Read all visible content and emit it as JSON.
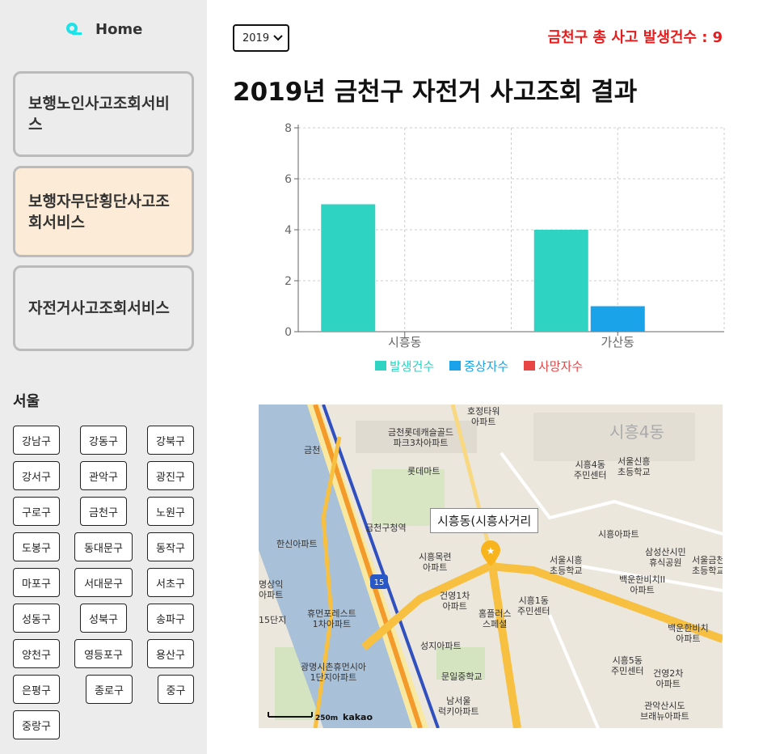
{
  "sidebar": {
    "home_label": "Home",
    "services": [
      {
        "label": "보행노인사고조회서비스",
        "active": false
      },
      {
        "label": "보행자무단횡단사고조회서비스",
        "active": true
      },
      {
        "label": "자전거사고조회서비스",
        "active": false
      }
    ],
    "region_title": "서울",
    "districts": [
      "강남구",
      "강동구",
      "강북구",
      "강서구",
      "관악구",
      "광진구",
      "구로구",
      "금천구",
      "노원구",
      "도봉구",
      "동대문구",
      "동작구",
      "마포구",
      "서대문구",
      "서초구",
      "성동구",
      "성북구",
      "송파구",
      "양천구",
      "영등포구",
      "용산구",
      "은평구",
      "종로구",
      "중구",
      "중랑구"
    ]
  },
  "header": {
    "year_selected": "2019",
    "total_label": "금천구 총 사고 발생건수 :",
    "total_count": "9",
    "title": "2019년 금천구 자전거 사고조회 결과"
  },
  "chart_data": {
    "type": "bar",
    "categories": [
      "시흥동",
      "가산동"
    ],
    "series": [
      {
        "name": "발생건수",
        "values": [
          5,
          4
        ],
        "color": "#2ed3c1"
      },
      {
        "name": "중상자수",
        "values": [
          0,
          1
        ],
        "color": "#1aa3e8"
      },
      {
        "name": "사망자수",
        "values": [
          0,
          0
        ],
        "color": "#e84545"
      }
    ],
    "ylim": [
      0,
      8
    ],
    "yticks": [
      0,
      2,
      4,
      6,
      8
    ],
    "grid": true,
    "legend": "bottom"
  },
  "map": {
    "tooltip": "시흥동(시흥사거리",
    "labels": [
      "호정타워 아파트",
      "금천롯데캐슬골드 파크3차아파트",
      "롯데마트",
      "시흥4동",
      "시흥4동 주민센터",
      "서울신흥 초등학교",
      "금천구청역",
      "한신아파트",
      "시흥목련 아파트",
      "시흥아파트",
      "삼성산시민 휴식공원",
      "서울시흥 초등학교",
      "서울금천 초등학교",
      "백운한비치II 아파트",
      "명상익 아파트",
      "휴먼포레스트 1차아파트",
      "건영1차 아파트",
      "시흥1동 주민센터",
      "홈플러스 스페셜",
      "백운한비치 아파트",
      "성지아파트",
      "광명시촌휴먼시아 1단지아파트",
      "문일중학교",
      "시흥5동 주민센터",
      "건영2차 아파트",
      "남서울 럭키아파트",
      "관악산시도 브래뉴아파트",
      "금천",
      "15단지",
      "250m",
      "kakao"
    ]
  }
}
